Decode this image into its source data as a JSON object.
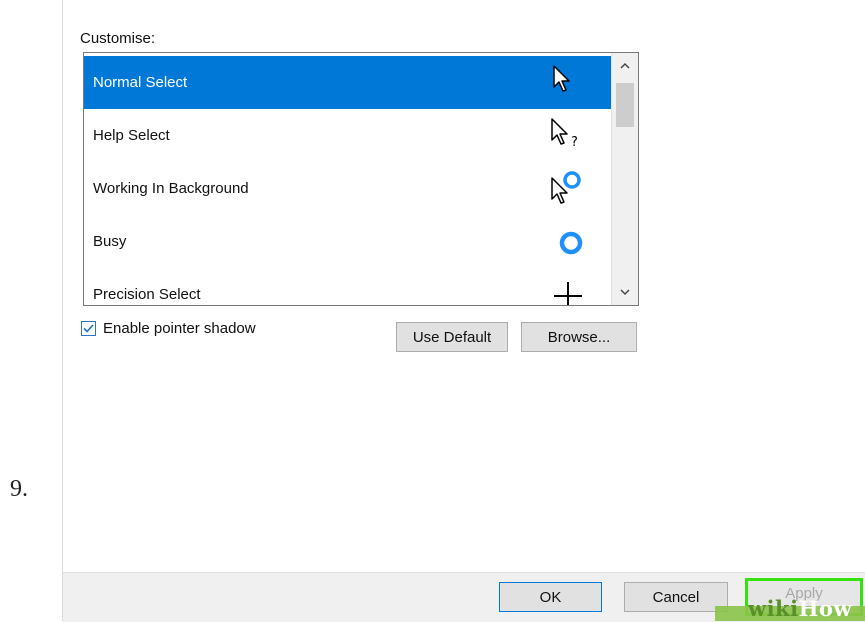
{
  "step_number": "9.",
  "dialog": {
    "customise_label": "Customise:",
    "cursor_list": [
      {
        "label": "Normal Select",
        "icon": "arrow-cursor-icon",
        "selected": true
      },
      {
        "label": "Help Select",
        "icon": "help-cursor-icon",
        "selected": false
      },
      {
        "label": "Working In Background",
        "icon": "working-cursor-icon",
        "selected": false
      },
      {
        "label": "Busy",
        "icon": "busy-cursor-icon",
        "selected": false
      },
      {
        "label": "Precision Select",
        "icon": "crosshair-cursor-icon",
        "selected": false
      }
    ],
    "enable_shadow": {
      "label": "Enable pointer shadow",
      "checked": true
    },
    "use_default_label": "Use Default",
    "browse_label": "Browse...",
    "ok_label": "OK",
    "cancel_label": "Cancel",
    "apply_label": "Apply"
  },
  "watermark": {
    "wiki": "wiki",
    "how": "How"
  },
  "colors": {
    "selection": "#0078d7",
    "highlight": "#35e00f",
    "watermark_green": "#8bc34a"
  }
}
